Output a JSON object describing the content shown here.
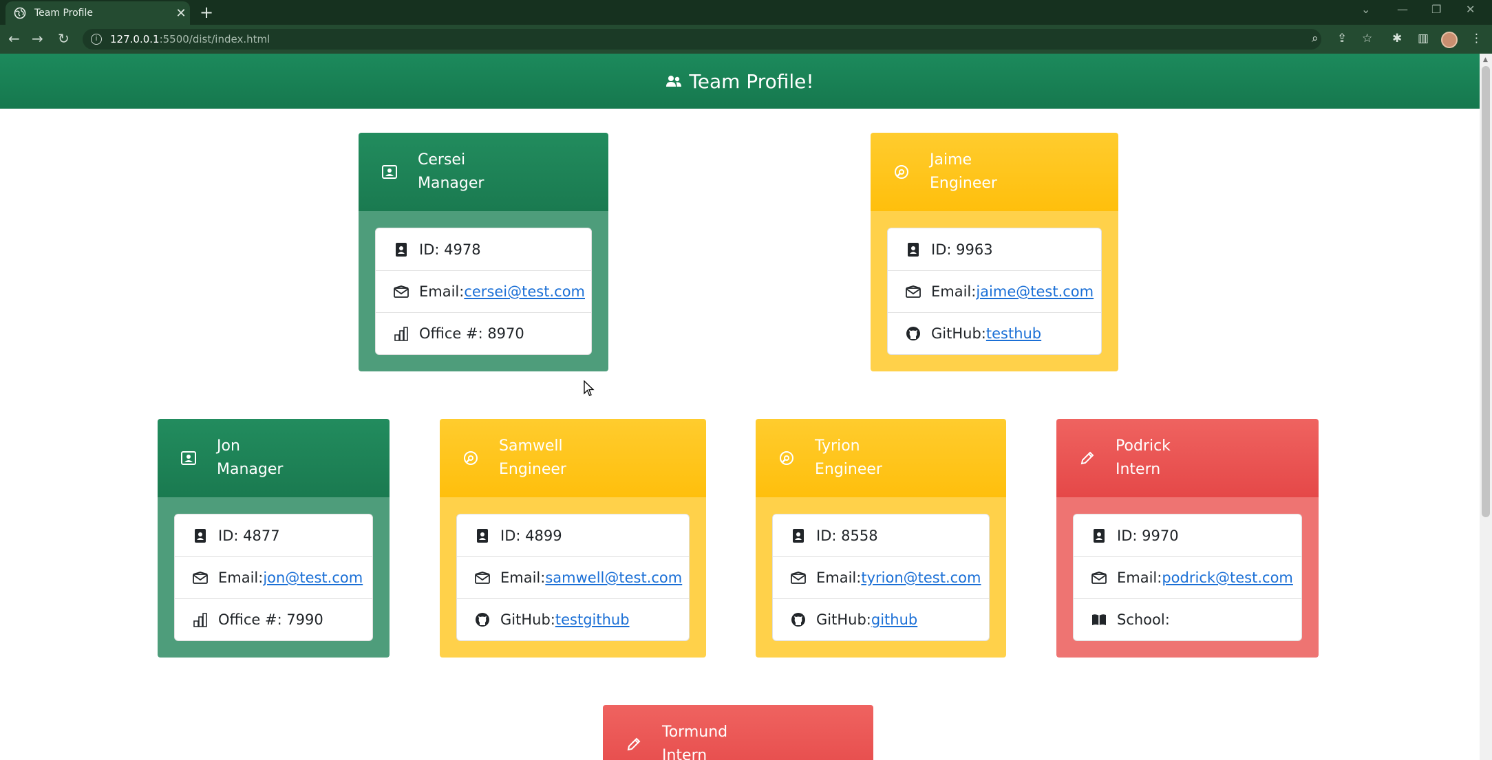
{
  "browser": {
    "tab_title": "Team Profile",
    "url_host": "127.0.0.1",
    "url_path": ":5500/dist/index.html"
  },
  "page": {
    "heading": "Team Profile!"
  },
  "cards": [
    {
      "name": "Cersei",
      "role": "Manager",
      "id": "ID: 4978",
      "email_label": "Email: ",
      "email": "cersei@test.com",
      "extra_label": "Office #: 8970",
      "extra_link": ""
    },
    {
      "name": "Jaime",
      "role": "Engineer",
      "id": "ID: 9963",
      "email_label": "Email: ",
      "email": "jaime@test.com",
      "extra_label": "GitHub: ",
      "extra_link": "testhub"
    },
    {
      "name": "Jon",
      "role": "Manager",
      "id": "ID: 4877",
      "email_label": "Email: ",
      "email": "jon@test.com",
      "extra_label": "Office #: 7990",
      "extra_link": ""
    },
    {
      "name": "Samwell",
      "role": "Engineer",
      "id": "ID: 4899",
      "email_label": "Email: ",
      "email": "samwell@test.com",
      "extra_label": "GitHub: ",
      "extra_link": "testgithub"
    },
    {
      "name": "Tyrion",
      "role": "Engineer",
      "id": "ID: 8558",
      "email_label": "Email: ",
      "email": "tyrion@test.com",
      "extra_label": "GitHub: ",
      "extra_link": "github"
    },
    {
      "name": "Podrick",
      "role": "Intern",
      "id": "ID: 9970",
      "email_label": "Email: ",
      "email": "podrick@test.com",
      "extra_label": "School:",
      "extra_link": ""
    },
    {
      "name": "Tormund",
      "role": "Intern"
    }
  ],
  "colors": {
    "manager": "#1a7a50",
    "engineer": "#ffbf0c",
    "intern": "#e54848",
    "link": "#1a6fd6"
  },
  "icons": {
    "manager": "person-badge-icon",
    "engineer": "gear-wrench-icon",
    "intern": "pencil-icon",
    "id": "id-badge-icon",
    "email": "envelope-icon",
    "office": "building-icon",
    "github": "github-icon",
    "school": "book-icon"
  }
}
